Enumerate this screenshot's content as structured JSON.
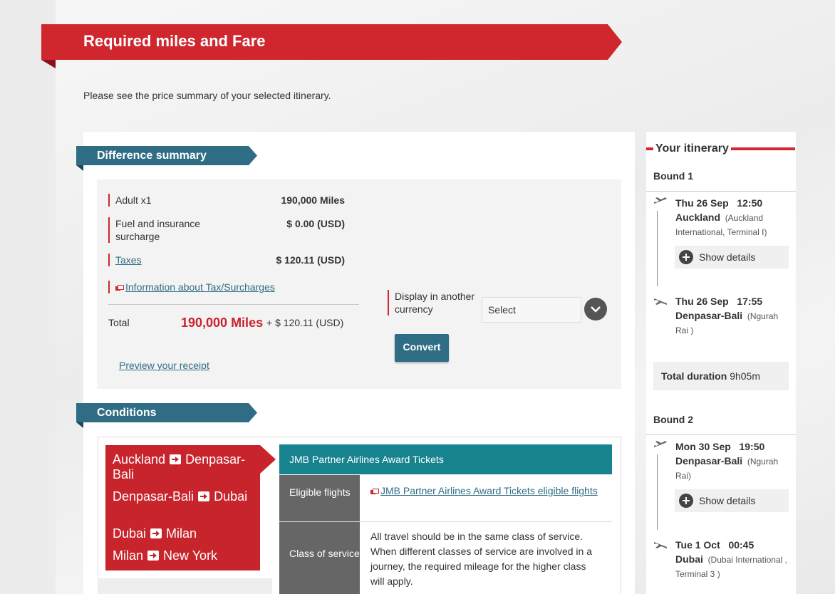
{
  "page": {
    "title": "Required miles and Fare",
    "intro": "Please see the price summary of your selected itinerary."
  },
  "difference_summary": {
    "heading": "Difference summary",
    "adult_label": "Adult x1",
    "adult_value": "190,000 Miles",
    "fuel_label": "Fuel and insurance surcharge",
    "fuel_value": "$ 0.00 (USD)",
    "taxes_label": "Taxes",
    "taxes_value": "$ 120.11 (USD)",
    "tax_info_link": "Information about Tax/Surcharges",
    "total_label": "Total",
    "total_miles": "190,000 Miles",
    "total_extra": "+ $ 120.11 (USD)",
    "preview_link": "Preview your receipt",
    "currency_label": "Display in another currency",
    "currency_select": "Select",
    "convert_button": "Convert"
  },
  "conditions": {
    "heading": "Conditions",
    "routes": [
      {
        "from": "Auckland",
        "to": "Denpasar-Bali"
      },
      {
        "from": "Denpasar-Bali",
        "to": "Dubai"
      },
      {
        "from": "Dubai",
        "to": "Milan"
      },
      {
        "from": "Milan",
        "to": "New York"
      }
    ],
    "program": "JMB Partner Airlines Award Tickets",
    "eligible_label": "Eligible flights",
    "eligible_link": "JMB Partner Airlines Award Tickets eligible flights",
    "class_label": "Class of service",
    "class_text": "All travel should be in the same class of service. When different classes of service are involved in a journey, the required mileage for the higher class will apply."
  },
  "itinerary": {
    "title": "Your itinerary",
    "show_details": "Show details",
    "bound1": {
      "label": "Bound 1",
      "dep_date": "Thu 26 Sep",
      "dep_time": "12:50",
      "dep_city": "Auckland",
      "dep_airport": "(Auckland International, Terminal  I)",
      "arr_date": "Thu 26 Sep",
      "arr_time": "17:55",
      "arr_city": "Denpasar-Bali",
      "arr_airport": "(Ngurah Rai )",
      "duration_label": "Total duration",
      "duration_value": "9h05m"
    },
    "bound2": {
      "label": "Bound 2",
      "dep_date": "Mon 30 Sep",
      "dep_time": "19:50",
      "dep_city": "Denpasar-Bali",
      "dep_airport": "(Ngurah Rai)",
      "arr_date": "Tue 1 Oct",
      "arr_time": "00:45",
      "arr_city": "Dubai",
      "arr_airport": "(Dubai International , Terminal  3 )"
    }
  },
  "colors": {
    "brand_red": "#d0272f",
    "ribbon_teal": "#2f6d84",
    "condition_teal": "#17838f"
  }
}
